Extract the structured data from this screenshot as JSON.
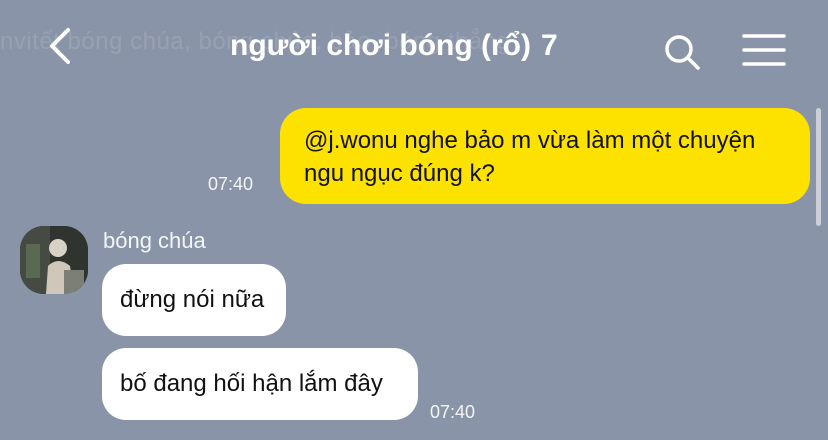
{
  "header": {
    "ghost_text": "nvitết bóng chúa, bóng chúa, bảo, bóng thẳng",
    "title": "người chơi bóng (rổ)",
    "member_count": "7"
  },
  "icons": {
    "back": "chevron-left-icon",
    "search": "search-icon",
    "menu": "hamburger-menu-icon"
  },
  "colors": {
    "background": "#8a94a8",
    "outgoing_bubble": "#fde200",
    "incoming_bubble": "#ffffff"
  },
  "messages": [
    {
      "direction": "outgoing",
      "text": "@j.wonu nghe bảo m vừa làm một chuyện ngu ngục đúng k?",
      "time": "07:40"
    },
    {
      "direction": "incoming",
      "sender": "bóng chúa",
      "texts": [
        "đừng nói nữa",
        "bố đang hối hận lắm đây"
      ],
      "time": "07:40"
    }
  ]
}
